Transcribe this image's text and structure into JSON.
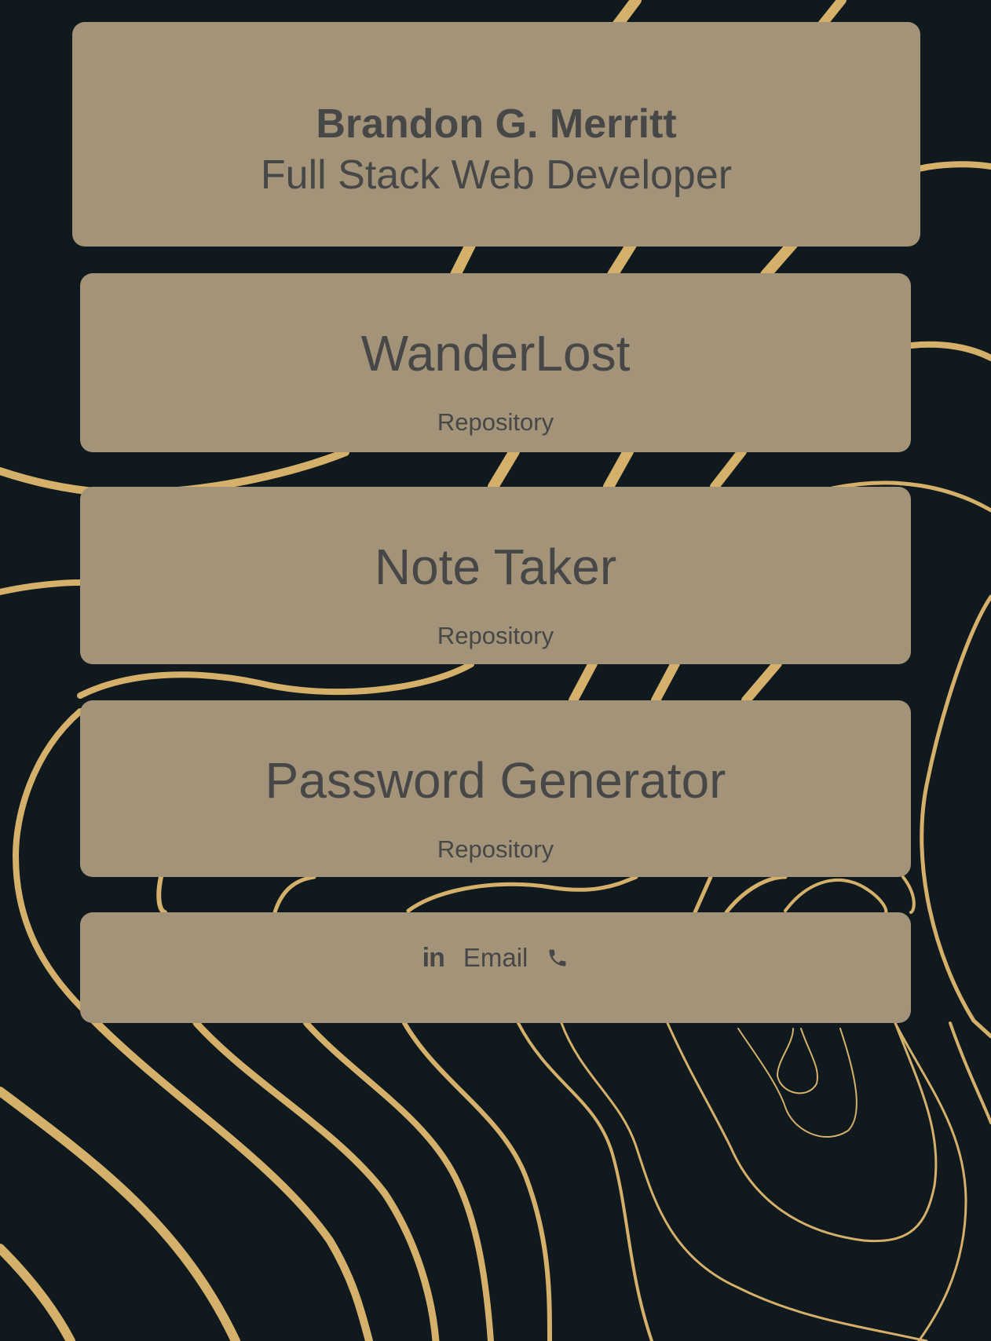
{
  "header": {
    "name": "Brandon G. Merritt",
    "role": "Full Stack Web Developer"
  },
  "projects": [
    {
      "title": "WanderLost",
      "link_label": "Repository"
    },
    {
      "title": "Note Taker",
      "link_label": "Repository"
    },
    {
      "title": "Password Generator",
      "link_label": "Repository"
    }
  ],
  "contact": {
    "linkedin_label": "in",
    "email_label": "Email",
    "phone_icon": "phone-icon"
  },
  "colors": {
    "background": "#0f191e",
    "card": "#a39378",
    "text": "#474747",
    "contour_lines": "#d4b06a"
  }
}
